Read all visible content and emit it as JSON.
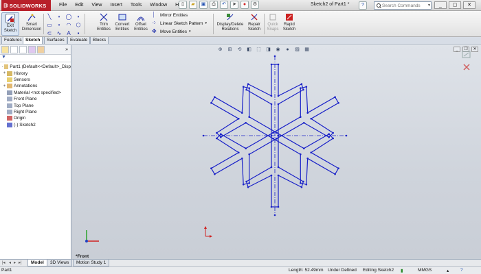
{
  "app": {
    "logo": "SOLIDWORKS",
    "document_title": "Sketch2 of Part1 *",
    "menu": [
      "File",
      "Edit",
      "View",
      "Insert",
      "Tools",
      "Window",
      "Help"
    ]
  },
  "search": {
    "placeholder": "Search Commands"
  },
  "toolbar": {
    "exit_sketch": "Exit Sketch",
    "smart_dimension": "Smart Dimension",
    "trim_entities": "Trim Entities",
    "convert_entities": "Convert Entities",
    "offset_entities": "Offset Entities",
    "mirror_entities": "Mirror Entities",
    "linear_sketch_pattern": "Linear Sketch Pattern",
    "move_entities": "Move Entities",
    "display_delete_relations": "Display/Delete Relations",
    "repair_sketch": "Repair Sketch",
    "quick_snaps": "Quick Snaps",
    "rapid_sketch": "Rapid Sketch"
  },
  "tabs": [
    "Features",
    "Sketch",
    "Surfaces",
    "Evaluate",
    "Blocks"
  ],
  "active_tab": "Sketch",
  "tree": [
    {
      "label": "Part1  (Default<<Default>_Disp",
      "expand": "-",
      "icon": "part-icon"
    },
    {
      "label": "History",
      "expand": "+",
      "icon": "history-icon"
    },
    {
      "label": "Sensors",
      "expand": "",
      "icon": "sensors-icon"
    },
    {
      "label": "Annotations",
      "expand": "+",
      "icon": "annotations-icon"
    },
    {
      "label": "Material <not specified>",
      "expand": "",
      "icon": "material-icon"
    },
    {
      "label": "Front Plane",
      "expand": "",
      "icon": "plane-icon"
    },
    {
      "label": "Top Plane",
      "expand": "",
      "icon": "plane-icon"
    },
    {
      "label": "Right Plane",
      "expand": "",
      "icon": "plane-icon"
    },
    {
      "label": "Origin",
      "expand": "",
      "icon": "origin-icon"
    },
    {
      "label": "(-) Sketch2",
      "expand": "",
      "icon": "sketch-icon"
    }
  ],
  "viewport": {
    "orientation_label": "*Front"
  },
  "bottom_tabs": [
    "Model",
    "3D Views",
    "Motion Study 1"
  ],
  "status": {
    "doc": "Part1",
    "length": "Length: 52.49mm",
    "definition": "Under Defined",
    "editing": "Editing Sketch2",
    "units": "MMGS"
  },
  "colors": {
    "sketch_line": "#1a22c8",
    "logo_red": "#b8202a",
    "viewport_bg": "#cfd4dc"
  }
}
